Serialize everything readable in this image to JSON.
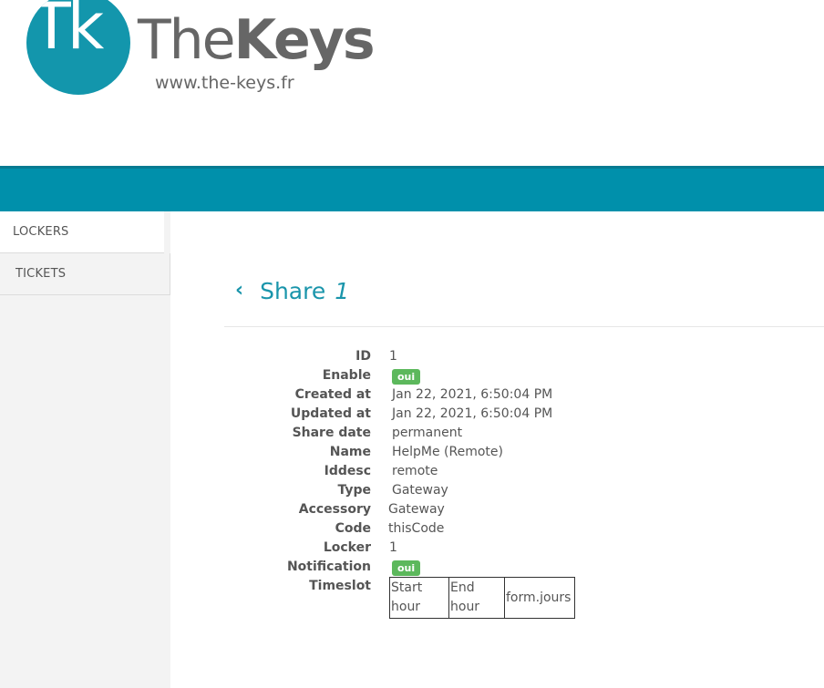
{
  "brand": {
    "logo_letters": "Tk",
    "name_light": "The",
    "name_bold": "Keys",
    "url": "www.the-keys.fr",
    "color_primary": "#0090ab"
  },
  "sidebar": {
    "items": [
      {
        "label": "LOCKERS",
        "active": true
      },
      {
        "label": "TICKETS",
        "active": false
      }
    ]
  },
  "page": {
    "back_icon": "chevron-left-icon",
    "title": "Share",
    "title_id": "1"
  },
  "details": {
    "id": {
      "label": "ID",
      "value": "1"
    },
    "enable": {
      "label": "Enable",
      "value": "oui"
    },
    "created_at": {
      "label": "Created at",
      "value": "Jan 22, 2021, 6:50:04 PM"
    },
    "updated_at": {
      "label": "Updated at",
      "value": "Jan 22, 2021, 6:50:04 PM"
    },
    "share_date": {
      "label": "Share date",
      "value": "permanent"
    },
    "name": {
      "label": "Name",
      "value": "HelpMe (Remote)"
    },
    "iddesc": {
      "label": "Iddesc",
      "value": "remote"
    },
    "type": {
      "label": "Type",
      "value": "Gateway"
    },
    "accessory": {
      "label": "Accessory",
      "value": "Gateway"
    },
    "code": {
      "label": "Code",
      "value": "thisCode"
    },
    "locker": {
      "label": "Locker",
      "value": "1"
    },
    "notification": {
      "label": "Notification",
      "value": "oui"
    },
    "timeslot": {
      "label": "Timeslot",
      "headers": [
        "Start hour",
        "End hour",
        "form.jours"
      ]
    }
  }
}
